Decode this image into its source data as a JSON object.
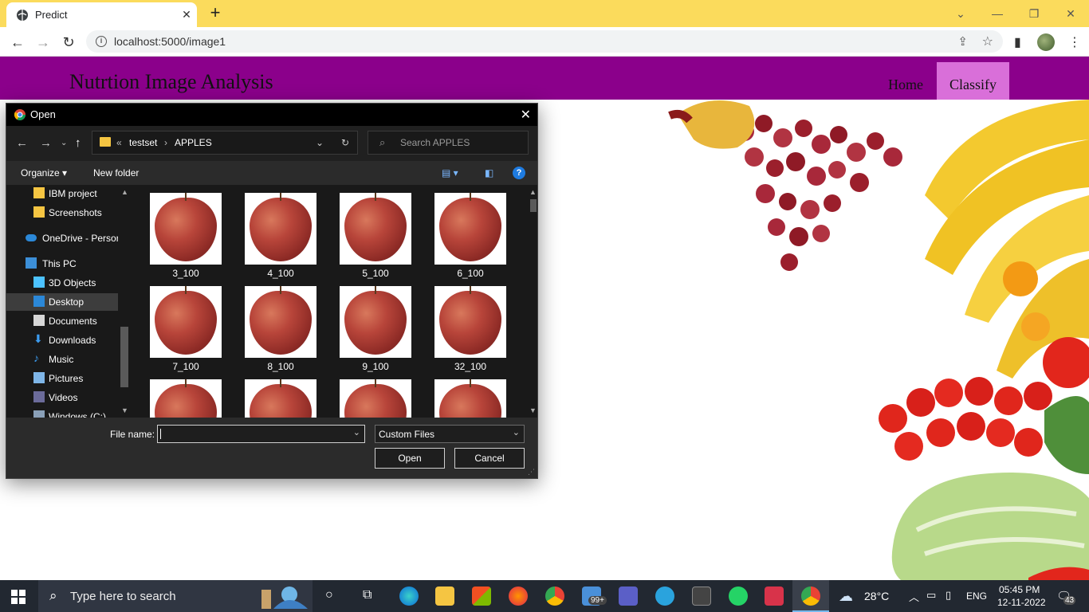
{
  "browser": {
    "tab_title": "Predict",
    "tab_close": "✕",
    "new_tab": "+",
    "url": "localhost:5000/image1",
    "window_controls": [
      "⌄",
      "—",
      "❐",
      "✕"
    ]
  },
  "site": {
    "title": "Nutrtion Image Analysis",
    "nav": {
      "home": "Home",
      "classify": "Classify"
    },
    "colors": {
      "header_bg": "#8b008b",
      "active_nav_bg": "#d96fd9"
    }
  },
  "dialog": {
    "title": "Open",
    "close": "✕",
    "breadcrumb": {
      "prefix": "«",
      "segments": [
        "testset",
        "APPLES"
      ]
    },
    "search_placeholder": "Search APPLES",
    "toolbar": {
      "organize": "Organize",
      "new_folder": "New folder",
      "help": "?"
    },
    "nav_items": [
      {
        "label": "IBM project",
        "icon": "folder-icon"
      },
      {
        "label": "Screenshots",
        "icon": "folder-icon"
      },
      {
        "label": "OneDrive - Persor",
        "icon": "cloud-icon"
      },
      {
        "label": "This PC",
        "icon": "computer-icon"
      },
      {
        "label": "3D Objects",
        "icon": "cube-icon"
      },
      {
        "label": "Desktop",
        "icon": "desktop-icon",
        "selected": true
      },
      {
        "label": "Documents",
        "icon": "document-icon"
      },
      {
        "label": "Downloads",
        "icon": "download-icon"
      },
      {
        "label": "Music",
        "icon": "music-icon"
      },
      {
        "label": "Pictures",
        "icon": "picture-icon"
      },
      {
        "label": "Videos",
        "icon": "video-icon"
      },
      {
        "label": "Windows (C:)",
        "icon": "drive-icon"
      }
    ],
    "files": [
      "3_100",
      "4_100",
      "5_100",
      "6_100",
      "7_100",
      "8_100",
      "9_100",
      "32_100",
      "",
      "",
      "",
      ""
    ],
    "file_name_label": "File name:",
    "file_name_value": "",
    "file_type": "Custom Files",
    "buttons": {
      "open": "Open",
      "cancel": "Cancel"
    }
  },
  "taskbar": {
    "search_placeholder": "Type here to search",
    "weather": "28°C",
    "language": "ENG",
    "time": "05:45 PM",
    "date": "12-11-2022",
    "mail_badge": "99+",
    "notification_count": "43"
  }
}
